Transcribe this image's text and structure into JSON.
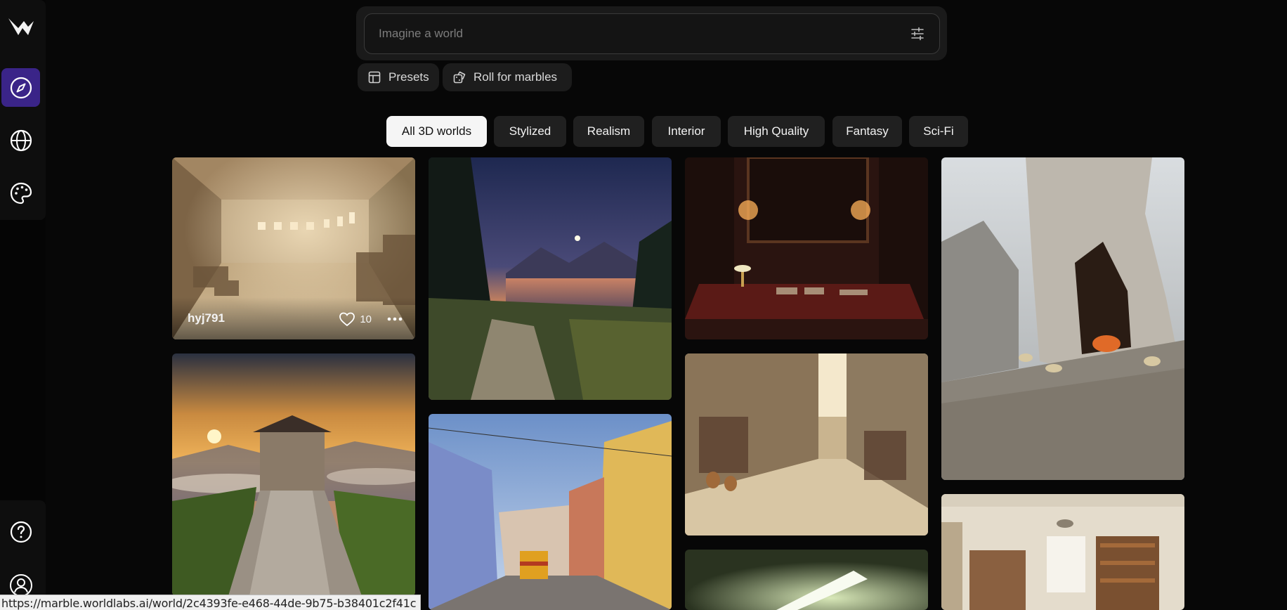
{
  "app": {
    "name": "World Labs Marble",
    "logo_icon": "worldlabs-logo-icon"
  },
  "sidebar": {
    "items": [
      {
        "name": "explore",
        "icon": "compass-icon",
        "active": true
      },
      {
        "name": "worlds",
        "icon": "globe-icon",
        "active": false
      },
      {
        "name": "styles",
        "icon": "palette-icon",
        "active": false
      }
    ],
    "bottom": [
      {
        "name": "help",
        "icon": "help-icon"
      },
      {
        "name": "account",
        "icon": "user-icon"
      }
    ]
  },
  "search": {
    "placeholder": "Imagine a world",
    "value": "",
    "settings_icon": "sliders-icon"
  },
  "actions": {
    "presets_label": "Presets",
    "roll_label": "Roll for marbles"
  },
  "filters": [
    {
      "label": "All 3D worlds",
      "selected": true
    },
    {
      "label": "Stylized",
      "selected": false
    },
    {
      "label": "Realism",
      "selected": false
    },
    {
      "label": "Interior",
      "selected": false
    },
    {
      "label": "High Quality",
      "selected": false
    },
    {
      "label": "Fantasy",
      "selected": false
    },
    {
      "label": "Sci-Fi",
      "selected": false
    }
  ],
  "gallery": {
    "cards": [
      {
        "scene": "sand-tomb-interior",
        "user": "hyj791",
        "likes": "10",
        "hovered": true
      },
      {
        "scene": "lake-sunset-mountains"
      },
      {
        "scene": "dark-study-desk"
      },
      {
        "scene": "rock-cave-fire"
      },
      {
        "scene": "great-wall-sunrise"
      },
      {
        "scene": "lisbon-street-tram"
      },
      {
        "scene": "sandy-old-street"
      },
      {
        "scene": "fluorescent-light-room"
      },
      {
        "scene": "cozy-bedroom-bookshelf"
      }
    ]
  },
  "status_bar": {
    "url": "https://marble.worldlabs.ai/world/2c4393fe-e468-44de-9b75-b38401c2f41c"
  },
  "colors": {
    "background": "#070707",
    "sidebar_active": "#3a2488",
    "filter_selected_bg": "#f5f5f5",
    "filter_bg": "#202020"
  }
}
